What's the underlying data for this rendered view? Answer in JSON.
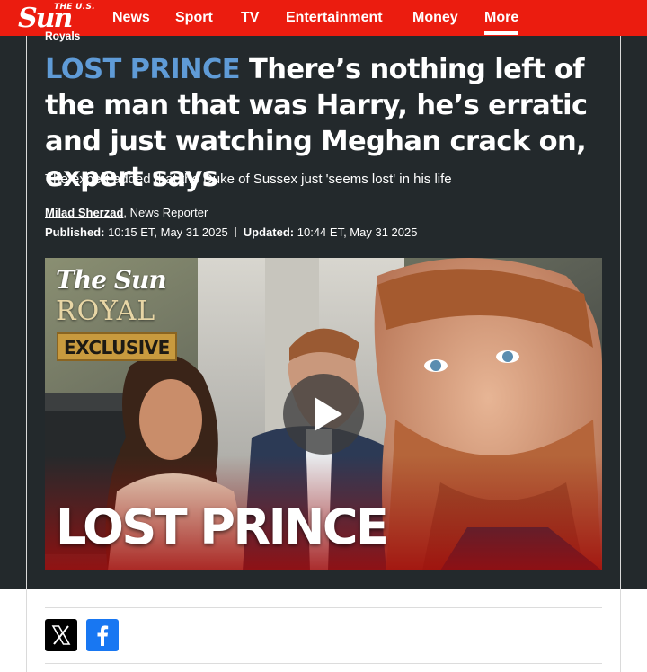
{
  "nav": {
    "logo_top": "THE U.S.",
    "logo_main": "Sun",
    "items": [
      {
        "label": "News"
      },
      {
        "label": "Sport"
      },
      {
        "label": "TV"
      },
      {
        "label": "Entertainment"
      },
      {
        "label": "Money"
      },
      {
        "label": "More",
        "active": true
      }
    ]
  },
  "article": {
    "kicker": "Royals",
    "headline_tag": "LOST PRINCE",
    "headline_text": "There’s nothing left of the man that was Harry, he’s erratic and just watching Meghan crack on, expert says",
    "standfirst": "The expert added that the Duke of Sussex just 'seems lost' in his life",
    "author": "Milad Sherzad",
    "author_role": ", News Reporter",
    "published_label": "Published:",
    "published_value": "10:15 ET, May 31 2025",
    "updated_label": "Updated:",
    "updated_value": "10:44 ET, May 31 2025"
  },
  "video": {
    "brand_top": "The Sun",
    "brand_royal": "ROYAL",
    "brand_exclusive": "EXCLUSIVE",
    "title": "LOST PRINCE",
    "play_icon": "play-icon"
  },
  "share": {
    "x_icon": "x-icon",
    "facebook_icon": "facebook-icon"
  },
  "colors": {
    "brand_red": "#eb1c0f",
    "header_bg": "#23292c",
    "headline_tag": "#5f9bd7",
    "facebook_blue": "#1877f2"
  }
}
